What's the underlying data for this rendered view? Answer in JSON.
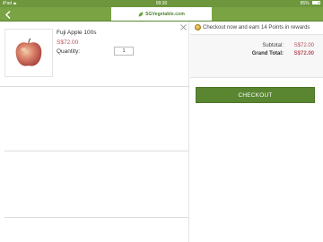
{
  "status_bar": {
    "carrier": "iPad",
    "wifi_icon": "wifi-icon",
    "time": "09:30",
    "battery": "85%"
  },
  "navbar": {
    "back_icon": "chevron-left-icon",
    "logo_text": "SGVegetable.com",
    "color": "#7aa344"
  },
  "cart": {
    "items": [
      {
        "name": "Fuji Apple 100s",
        "price": "S$72.00",
        "quantity_label": "Quantity:",
        "quantity": "1"
      }
    ]
  },
  "rewards": {
    "text": "Checkout now and earn 14 Points in rewards"
  },
  "summary": {
    "subtotal_label": "Subtotal:",
    "subtotal_value": "S$72.00",
    "grand_total_label": "Grand Total:",
    "grand_total_value": "S$72.00"
  },
  "checkout": {
    "label": "CHECKOUT",
    "color": "#5a8632"
  },
  "colors": {
    "price": "#b5505a",
    "brand_green": "#7aa344"
  }
}
